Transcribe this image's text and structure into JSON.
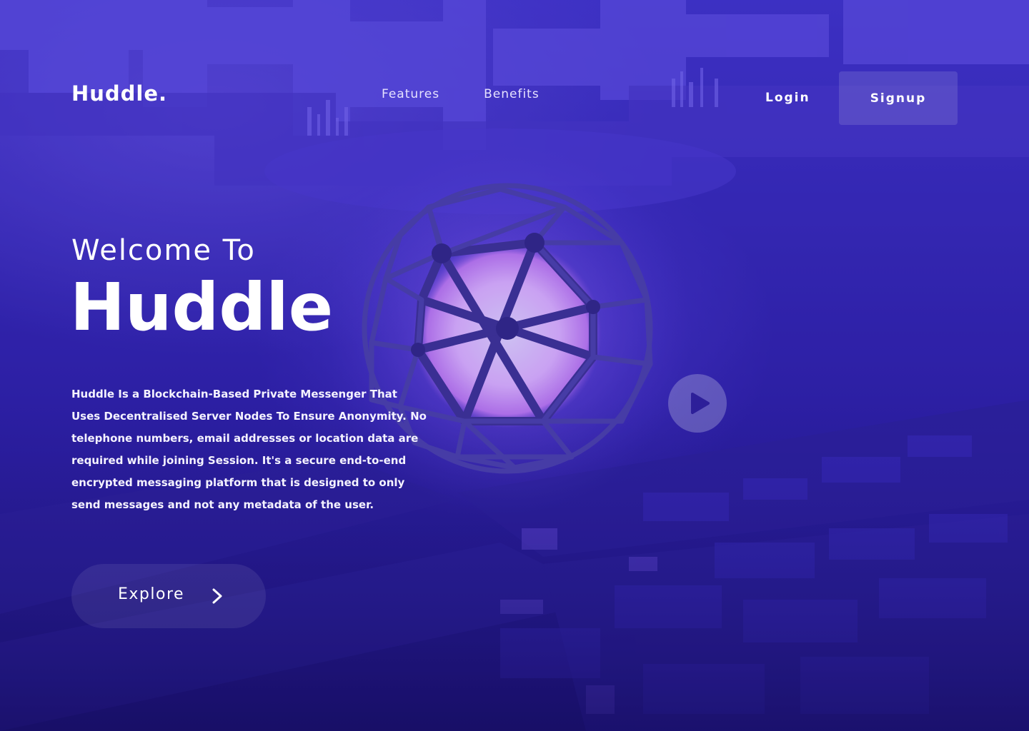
{
  "header": {
    "logo": "Huddle.",
    "nav": {
      "features": "Features",
      "benefits": "Benefits"
    },
    "login": "Login",
    "signup": "Signup"
  },
  "hero": {
    "welcome": "Welcome To",
    "title": "Huddle",
    "description": "Huddle Is a Blockchain-Based Private Messenger That Uses Decentralised Server Nodes To Ensure Anonymity. No telephone numbers, email addresses or location data are required while joining Session. It's a secure end-to-end encrypted messaging platform that is designed to only send messages and not any metadata of the user.",
    "explore_label": "Explore"
  },
  "icons": {
    "explore": "chevron-right-icon",
    "play": "play-icon"
  },
  "colors": {
    "background_top": "#3f33c8",
    "background_bottom": "#1a1170",
    "orb_glow": "#f2a8ff",
    "text": "#ffffff"
  }
}
